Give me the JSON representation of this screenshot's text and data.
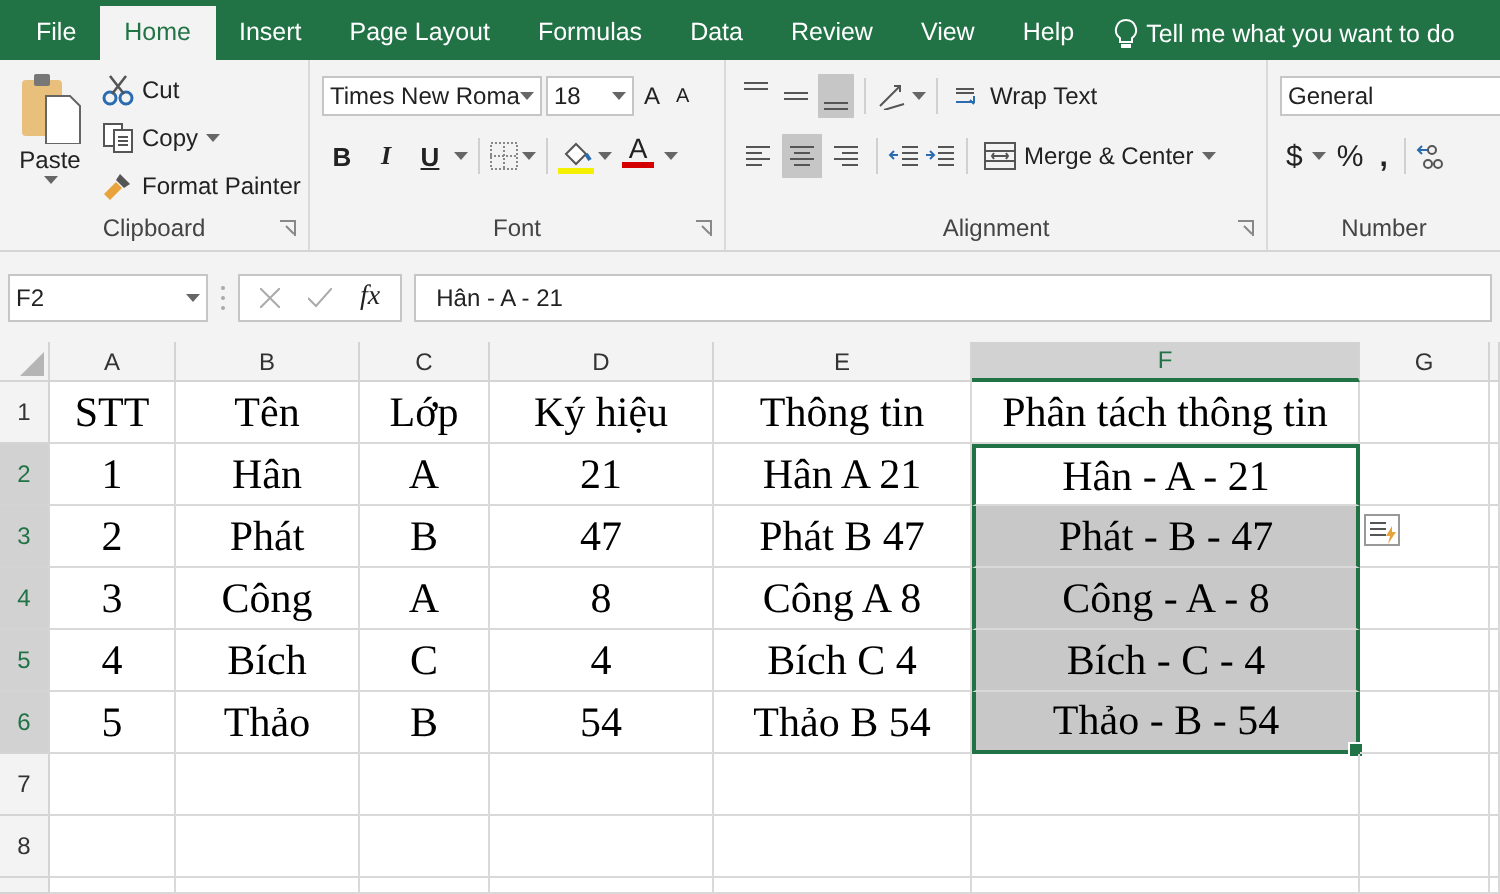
{
  "tabs": [
    {
      "label": "File",
      "selected": false
    },
    {
      "label": "Home",
      "selected": true
    },
    {
      "label": "Insert",
      "selected": false
    },
    {
      "label": "Page Layout",
      "selected": false
    },
    {
      "label": "Formulas",
      "selected": false
    },
    {
      "label": "Data",
      "selected": false
    },
    {
      "label": "Review",
      "selected": false
    },
    {
      "label": "View",
      "selected": false
    },
    {
      "label": "Help",
      "selected": false
    }
  ],
  "tell_me": "Tell me what you want to do",
  "clipboard": {
    "paste": "Paste",
    "cut": "Cut",
    "copy": "Copy",
    "format_painter": "Format Painter",
    "label": "Clipboard"
  },
  "font": {
    "name": "Times New Roma",
    "size": "18",
    "grow": "A",
    "shrink": "A",
    "bold": "B",
    "italic": "I",
    "underline": "U",
    "color_letter": "A",
    "label": "Font"
  },
  "alignment": {
    "vertical": [
      {
        "selected": false
      },
      {
        "selected": false
      },
      {
        "selected": true
      }
    ],
    "horizontal": [
      {
        "selected": false
      },
      {
        "selected": true
      },
      {
        "selected": false
      }
    ],
    "wrap_text": "Wrap Text",
    "merge_center": "Merge & Center",
    "label": "Alignment"
  },
  "number": {
    "format": "General",
    "currency": "$",
    "percent": "%",
    "comma": ",",
    "label": "Number"
  },
  "formula_bar": {
    "name_box": "F2",
    "fx": "fx",
    "formula": "Hân - A - 21"
  },
  "sheet": {
    "columns": [
      {
        "label": "A",
        "selected": false
      },
      {
        "label": "B",
        "selected": false
      },
      {
        "label": "C",
        "selected": false
      },
      {
        "label": "D",
        "selected": false
      },
      {
        "label": "E",
        "selected": false
      },
      {
        "label": "F",
        "selected": true
      },
      {
        "label": "G",
        "selected": false
      }
    ],
    "rows": [
      {
        "header": "1",
        "selected": false,
        "cells": [
          "STT",
          "Tên",
          "Lớp",
          "Ký hiệu",
          "Thông tin",
          "Phân tách thông tin"
        ]
      },
      {
        "header": "2",
        "selected": true,
        "cells": [
          "1",
          "Hân",
          "A",
          "21",
          "Hân A 21",
          "Hân - A - 21"
        ]
      },
      {
        "header": "3",
        "selected": true,
        "cells": [
          "2",
          "Phát",
          "B",
          "47",
          "Phát B 47",
          "Phát - B - 47"
        ]
      },
      {
        "header": "4",
        "selected": true,
        "cells": [
          "3",
          "Công",
          "A",
          "8",
          "Công A 8",
          "Công - A - 8"
        ]
      },
      {
        "header": "5",
        "selected": true,
        "cells": [
          "4",
          "Bích",
          "C",
          "4",
          "Bích C 4",
          "Bích - C - 4"
        ]
      },
      {
        "header": "6",
        "selected": true,
        "cells": [
          "5",
          "Thảo",
          "B",
          "54",
          "Thảo B 54",
          "Thảo - B - 54"
        ]
      },
      {
        "header": "7",
        "selected": false,
        "cells": []
      },
      {
        "header": "8",
        "selected": false,
        "cells": []
      }
    ]
  }
}
